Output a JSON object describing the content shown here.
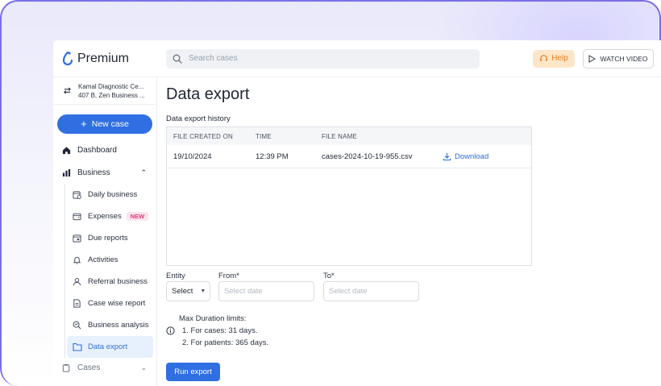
{
  "brand": {
    "name": "Premium",
    "accent": "#2f6fe2"
  },
  "topbar": {
    "search_placeholder": "Search cases",
    "help_label": "Help",
    "watch_label": "WATCH VIDEO"
  },
  "account": {
    "line1": "Kamal Diagnostic Ce...",
    "line2": "407 B, Zen Business ..."
  },
  "sidebar": {
    "new_case": "New case",
    "dashboard": "Dashboard",
    "business": "Business",
    "items": [
      {
        "label": "Daily business",
        "icon": "calendar-clock-icon"
      },
      {
        "label": "Expenses",
        "icon": "wallet-icon",
        "badge": "NEW"
      },
      {
        "label": "Due reports",
        "icon": "calendar-icon"
      },
      {
        "label": "Activities",
        "icon": "bell-icon"
      },
      {
        "label": "Referral business",
        "icon": "user-badge-icon"
      },
      {
        "label": "Case wise report",
        "icon": "document-icon"
      },
      {
        "label": "Business analysis",
        "icon": "search-chart-icon"
      },
      {
        "label": "Data export",
        "icon": "folder-icon",
        "active": true
      }
    ],
    "cases": "Cases"
  },
  "main": {
    "title": "Data export",
    "history_label": "Data export history",
    "columns": [
      "FILE CREATED ON",
      "TIME",
      "FILE NAME",
      ""
    ],
    "rows": [
      {
        "date": "19/10/2024",
        "time": "12:39 PM",
        "file": "cases-2024-10-19-955.csv",
        "action": "Download"
      }
    ],
    "form": {
      "entity_label": "Entity",
      "entity_value": "Select",
      "from_label": "From*",
      "from_placeholder": "Select date",
      "to_label": "To*",
      "to_placeholder": "Select date"
    },
    "limits": {
      "heading": "Max Duration limits:",
      "line1": "1. For cases: 31 days.",
      "line2": "2. For patients: 365 days."
    },
    "run_label": "Run export"
  }
}
